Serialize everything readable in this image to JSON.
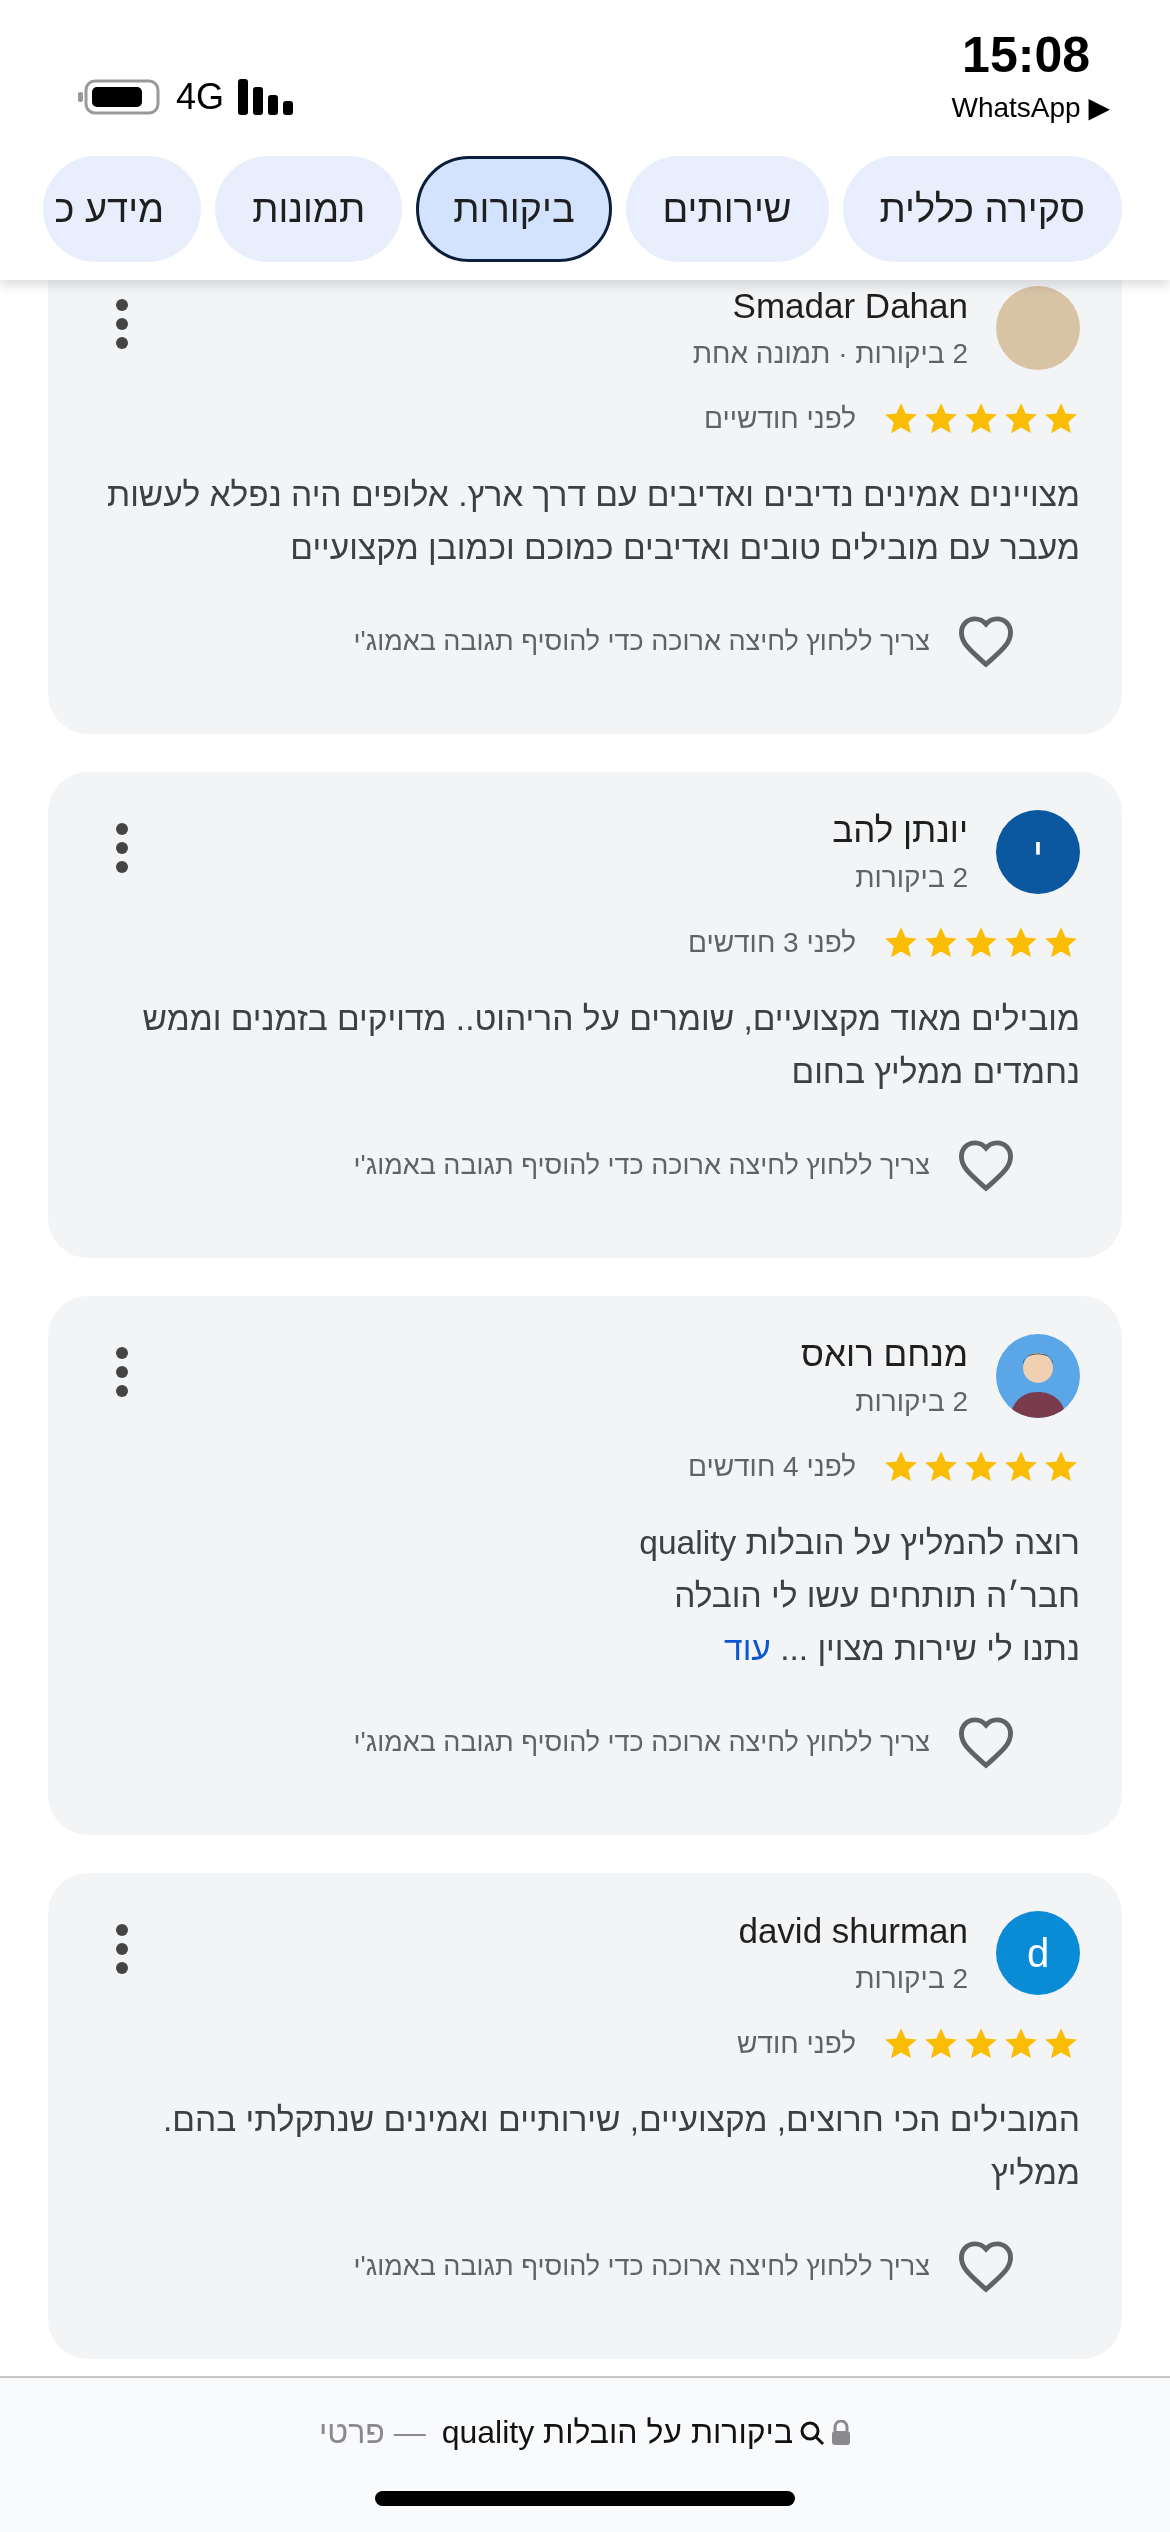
{
  "status_bar": {
    "time": "15:08",
    "back_app": "WhatsApp ▶",
    "network": "4G"
  },
  "tabs": [
    {
      "label": "סקירה כללית",
      "selected": false
    },
    {
      "label": "שירותים",
      "selected": false
    },
    {
      "label": "ביקורות",
      "selected": true
    },
    {
      "label": "תמונות",
      "selected": false
    },
    {
      "label": "מידע כ",
      "selected": false
    }
  ],
  "reviews": [
    {
      "name": "Smadar Dahan",
      "kind": "photo",
      "meta": "2 ביקורות · תמונה אחת",
      "stars": 5,
      "time": "לפני חודשיים",
      "text": "מצויינים אמינים נדיבים ואדיבים עם דרך ארץ. אלופים היה נפלא לעשות מעבר עם מובילים טובים ואדיבים כמוכם וכמובן מקצועיים",
      "reply_hint": "צריך ללחוץ לחיצה ארוכה כדי להוסיף תגובה באמוג'י",
      "clipped": true
    },
    {
      "name": "יונתן להב",
      "kind": "letter",
      "avatar_letter": "י",
      "color": "#0b57a0",
      "meta": "2 ביקורות",
      "stars": 5,
      "time": "לפני 3 חודשים",
      "text": "מובילים מאוד מקצועיים, שומרים על הריהוט.. מדויקים בזמנים וממש נחמדים ממליץ בחום",
      "reply_hint": "צריך ללחוץ לחיצה ארוכה כדי להוסיף תגובה באמוג'י",
      "clipped": false
    },
    {
      "name": "מנחם רואס",
      "kind": "illustration",
      "meta": "2 ביקורות",
      "stars": 5,
      "time": "לפני 4 חודשים",
      "text": "רוצה להמליץ על הובלות quality\nחבר׳ה תותחים עשו לי הובלה\nנתנו לי שירות מצוין ...",
      "more": "עוד",
      "reply_hint": "צריך ללחוץ לחיצה ארוכה כדי להוסיף תגובה באמוג'י",
      "clipped": false
    },
    {
      "name": "david shurman",
      "kind": "letter",
      "avatar_letter": "d",
      "color": "#0a8bd6",
      "meta": "2 ביקורות",
      "stars": 5,
      "time": "לפני חודש",
      "text": "המובילים הכי חרוצים, מקצועיים, שירותיים ואמינים שנתקלתי בהם. ממליץ",
      "reply_hint": "צריך ללחוץ לחיצה ארוכה כדי להוסיף תגובה באמוג'י",
      "clipped": false
    }
  ],
  "address_bar": {
    "title": "ביקורות על הובלות quality",
    "suffix": "— פרטי"
  }
}
